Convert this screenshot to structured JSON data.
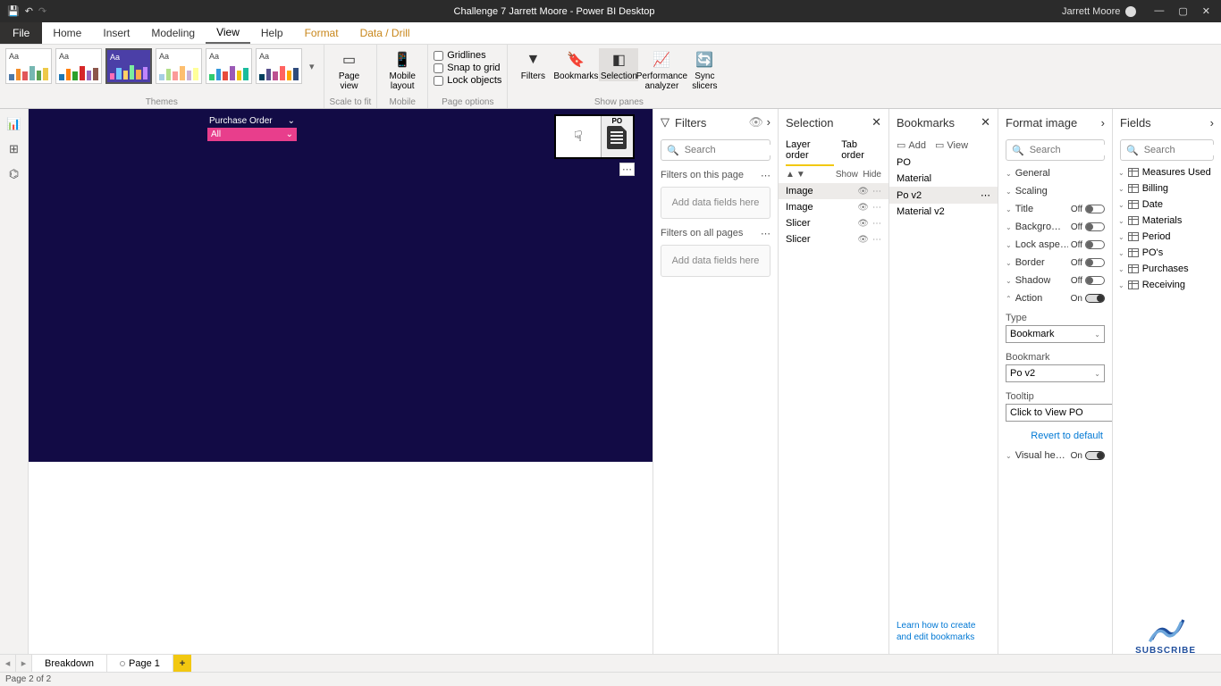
{
  "titlebar": {
    "title": "Challenge 7 Jarrett Moore - Power BI Desktop",
    "user": "Jarrett Moore"
  },
  "ribbon_tabs": {
    "file": "File",
    "tabs": [
      "Home",
      "Insert",
      "Modeling",
      "View",
      "Help",
      "Format",
      "Data / Drill"
    ],
    "active": "View"
  },
  "ribbon": {
    "groups": {
      "themes": "Themes",
      "scale": "Scale to fit",
      "mobile": "Mobile",
      "page_options": "Page options",
      "show_panes": "Show panes"
    },
    "page_view": "Page view",
    "mobile_layout": "Mobile layout",
    "gridlines": "Gridlines",
    "snap": "Snap to grid",
    "lock": "Lock objects",
    "panes": {
      "filters": "Filters",
      "bookmarks": "Bookmarks",
      "selection": "Selection",
      "perf": "Performance analyzer",
      "sync": "Sync slicers"
    }
  },
  "canvas": {
    "slicer_title": "Purchase Order",
    "slicer_value": "All",
    "img_label": "PO"
  },
  "filters_pane": {
    "title": "Filters",
    "search_ph": "Search",
    "this_page": "Filters on this page",
    "all_pages": "Filters on all pages",
    "drop_hint": "Add data fields here"
  },
  "selection_pane": {
    "title": "Selection",
    "layer": "Layer order",
    "tab": "Tab order",
    "show": "Show",
    "hide": "Hide",
    "items": [
      "Image",
      "Image",
      "Slicer",
      "Slicer"
    ]
  },
  "bookmarks_pane": {
    "title": "Bookmarks",
    "add": "Add",
    "view": "View",
    "items": [
      "PO",
      "Material",
      "Po v2",
      "Material v2"
    ],
    "selected": "Po v2",
    "learn": "Learn how to create and edit bookmarks"
  },
  "format_pane": {
    "title": "Format image",
    "search_ph": "Search",
    "props": {
      "general": "General",
      "scaling": "Scaling",
      "title": "Title",
      "background": "Backgro…",
      "lock": "Lock aspe…",
      "border": "Border",
      "shadow": "Shadow",
      "action": "Action",
      "visual_header": "Visual he…"
    },
    "off": "Off",
    "on": "On",
    "type_label": "Type",
    "type_value": "Bookmark",
    "bookmark_label": "Bookmark",
    "bookmark_value": "Po v2",
    "tooltip_label": "Tooltip",
    "tooltip_value": "Click to View PO",
    "revert": "Revert to default"
  },
  "fields_pane": {
    "title": "Fields",
    "search_ph": "Search",
    "tables": [
      "Measures Used",
      "Billing",
      "Date",
      "Materials",
      "Period",
      "PO's",
      "Purchases",
      "Receiving"
    ]
  },
  "page_tabs": {
    "tabs": [
      "Breakdown",
      "Page 1"
    ]
  },
  "status": "Page 2 of 2",
  "subscribe": "SUBSCRIBE"
}
